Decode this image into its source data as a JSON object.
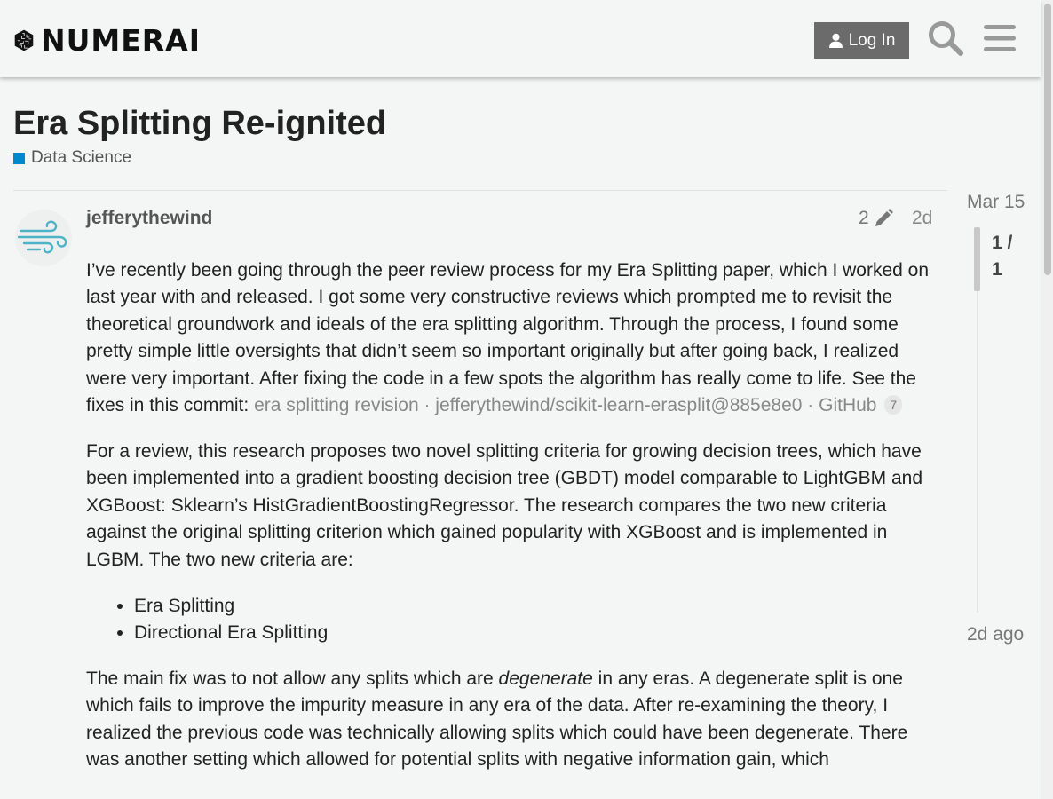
{
  "header": {
    "brand": "NUMERAI",
    "login_label": "Log In"
  },
  "topic": {
    "title": "Era Splitting Re-ignited",
    "category": "Data Science",
    "category_color": "#0088cc"
  },
  "post": {
    "username": "jefferythewind",
    "edit_count": "2",
    "age": "2d",
    "p1_text": "I’ve recently been going through the peer review process for my Era Splitting paper, which I worked on last year with and released. I got some very constructive reviews which prompted me to revisit the theoretical groundwork and ideals of the era splitting algorithm. Through the process, I found some pretty simple little oversights that didn’t seem so important originally but after going back, I realized were very important. After fixing the code in a few spots the algorithm has really come to life. See the fixes in this commit:",
    "link_text": "era splitting revision · jefferythewind/scikit-learn-erasplit@885e8e0 · GitHub",
    "link_clicks": "7",
    "p2_text": "For a review, this research proposes two novel splitting criteria for growing decision trees, which have been implemented into a gradient boosting decision tree (GBDT) model comparable to LightGBM and XGBoost: Sklearn’s HistGradientBoostingRegressor. The research compares the two new criteria against the original splitting criterion which gained popularity with XGBoost and is implemented in LGBM. The two new criteria are:",
    "list": [
      "Era Splitting",
      "Directional Era Splitting"
    ],
    "p3_before": "The main fix was to not allow any splits which are ",
    "p3_em": "degenerate",
    "p3_after": " in any eras. A degenerate split is one which fails to improve the impurity measure in any era of the data. After re-examining the theory, I realized the previous code was technically allowing splits which could have been degenerate. There was another setting which allowed for potential splits with negative information gain, which"
  },
  "timeline": {
    "start_date": "Mar 15",
    "position": "1 / 1",
    "end_label": "2d ago"
  }
}
